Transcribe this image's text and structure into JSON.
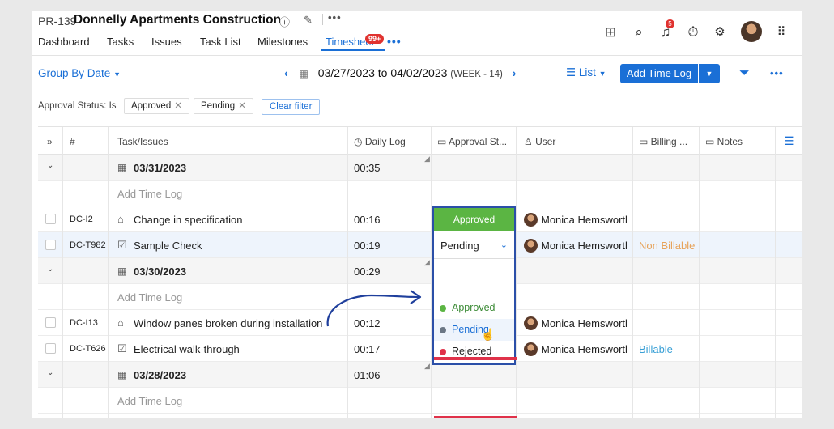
{
  "project": {
    "id": "PR-139",
    "title": "Donnelly Apartments Construction"
  },
  "tabs": [
    "Dashboard",
    "Tasks",
    "Issues",
    "Task List",
    "Milestones",
    "Timesheet"
  ],
  "tabs_badge": "99+",
  "notif_count": "5",
  "toolbar": {
    "group_by": "Group By Date",
    "date_range": "03/27/2023 to 04/02/2023",
    "week": "(WEEK - 14)",
    "view": "List",
    "add_button": "Add Time Log"
  },
  "filters": {
    "label": "Approval Status: Is",
    "chips": [
      "Approved",
      "Pending"
    ],
    "clear": "Clear filter"
  },
  "columns": [
    "#",
    "Task/Issues",
    "Daily Log",
    "Approval St...",
    "User",
    "Billing ...",
    "Notes"
  ],
  "add_time_log": "Add Time Log",
  "groups": [
    {
      "date": "03/31/2023",
      "total": "00:35"
    },
    {
      "date": "03/30/2023",
      "total": "00:29"
    },
    {
      "date": "03/28/2023",
      "total": "01:06"
    }
  ],
  "rows": [
    {
      "id": "DC-I2",
      "task": "Change in specification",
      "log": "00:16",
      "user": "Monica Hemswortl",
      "billing": ""
    },
    {
      "id": "DC-T982",
      "task": "Sample Check",
      "log": "00:19",
      "user": "Monica Hemswortl",
      "billing": "Non Billable"
    },
    {
      "id": "DC-I13",
      "task": "Window panes broken during installation",
      "log": "00:12",
      "user": "Monica Hemswortl",
      "billing": ""
    },
    {
      "id": "DC-T626",
      "task": "Electrical walk-through",
      "log": "00:17",
      "user": "Monica Hemswortl",
      "billing": "Billable"
    }
  ],
  "approval": {
    "approved_label": "Approved",
    "current": "Pending",
    "options": [
      {
        "label": "Approved",
        "color": "#5bb543"
      },
      {
        "label": "Pending",
        "color": "#6b7785"
      },
      {
        "label": "Rejected",
        "color": "#e0324a"
      }
    ]
  },
  "colors": {
    "accent": "#1a6fd6",
    "approved": "#5bb543",
    "rejected": "#e0324a",
    "billable": "#3aa0d6",
    "non_billable": "#e7a35a"
  }
}
